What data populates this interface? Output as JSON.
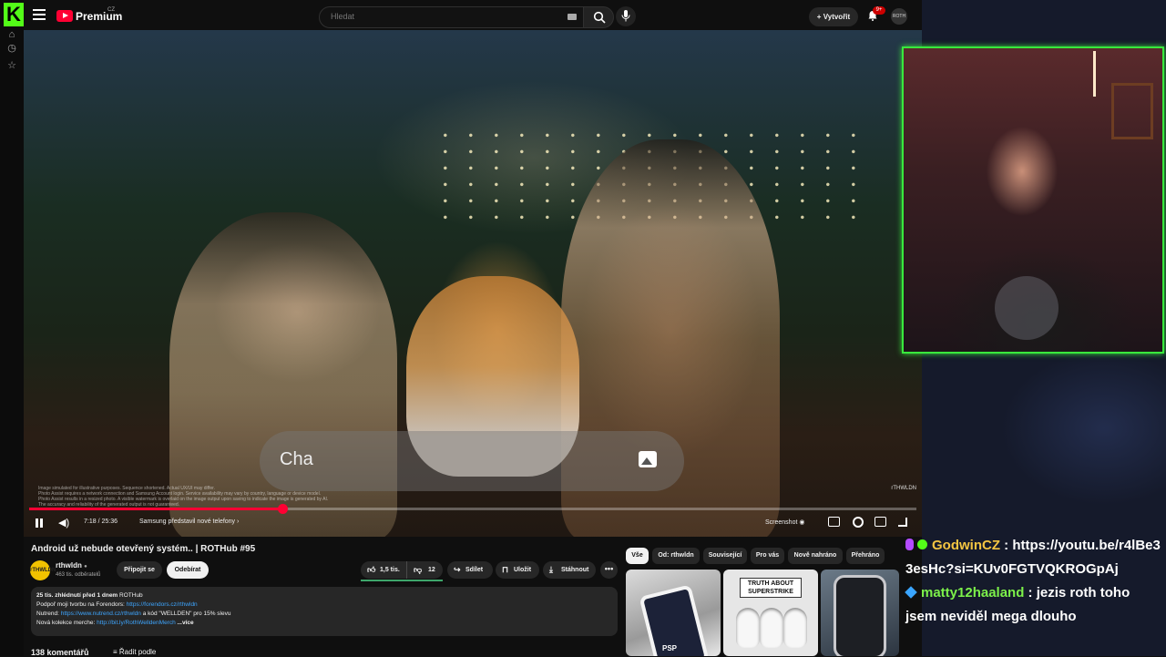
{
  "header": {
    "brand": "Premium",
    "brand_region": "CZ",
    "search_placeholder": "Hledat",
    "create_label": "Vytvořit",
    "notification_count": "9+",
    "account_avatar": "ROTH"
  },
  "player": {
    "overlay_text": "Cha",
    "disclaimer_lines": [
      "Image simulated for illustrative purposes. Sequence shortened. Actual UX/UI may differ.",
      "Photo Assist requires a network connection and Samsung Account login. Service availability may vary by country, language or device model.",
      "Photo Assist results in a resized photo. A visible watermark is overlaid on the image output upon saving to indicate the image is generated by AI.",
      "The accuracy and reliability of the generated output is not guaranteed."
    ],
    "watermark": "rTHWLDN",
    "current_time": "7:18",
    "duration": "25:36",
    "time_display": "7:18 / 25:36",
    "progress": 0.285,
    "chapter": "Samsung představil nové telefony",
    "chapter_arrow": "›",
    "screenshot_label": "Screenshot"
  },
  "video": {
    "title": "Android už nebude otevřený systém.. | ROTHub #95",
    "channel": {
      "name": "rthwldn",
      "verified": "●",
      "avatar_text": "rTHWLDN",
      "subscribers": "463 tis. odběratelů",
      "join_label": "Připojit se",
      "subscribe_label": "Odebírat"
    },
    "actions": {
      "likes": "1,5 tis.",
      "dislikes": "12",
      "share": "Sdílet",
      "save": "Uložit",
      "download": "Stáhnout",
      "more": "•••"
    },
    "description": {
      "meta": "25 tis. zhlédnutí  před 1 dnem",
      "tag": "ROTHub",
      "line1_text": "Podpoř moji tvorbu na Forendors: ",
      "line1_link": "https://forendors.cz/rthwldn",
      "line2_text": "Nutrend: ",
      "line2_link": "https://www.nutrend.cz/rthwldn",
      "line2_suffix": " a kód \"WELLDEN\" pro 15% slevu",
      "line3_text": "Nová kolekce merche: ",
      "line3_link": "http://bit.ly/RothWelldenMerch",
      "more": " ...více"
    },
    "comments_count": "138 komentářů",
    "sort_label": "Řadit podle"
  },
  "related": {
    "chips": [
      "Vše",
      "Od: rthwldn",
      "Související",
      "Pro vás",
      "Nově nahráno",
      "Přehráno"
    ],
    "active_chip": 0,
    "thumbnails": [
      {
        "label": "PSP"
      },
      {
        "label": "TRUTH ABOUT SUPERSTRIKE"
      },
      {
        "label": ""
      }
    ]
  },
  "chat": {
    "messages": [
      {
        "user": "GodwinCZ",
        "text": "https://youtu.be/r4lBe33esHc?si=KUv0FGTVQKROGpAj",
        "user_color": "#f4c542"
      },
      {
        "user": "matty12haaland",
        "text": "jezis roth toho jsem neviděl mega dlouho",
        "user_color": "#7cf04a"
      }
    ]
  },
  "icons": {
    "stream_logo": "K",
    "accent_green": "#53fc18",
    "youtube_red": "#ff0033"
  }
}
